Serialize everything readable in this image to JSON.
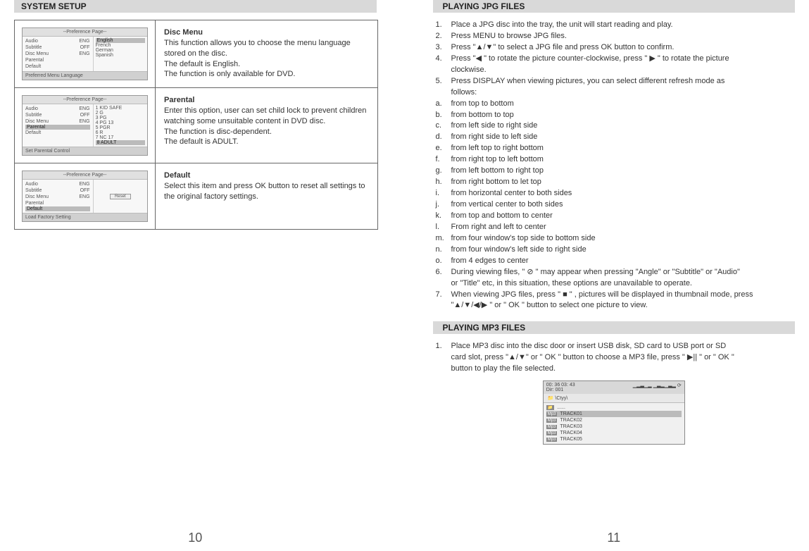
{
  "left": {
    "header": "SYSTEM SETUP",
    "rows": [
      {
        "title": "Disc Menu",
        "body1": "This function allows you to choose the menu language stored on the disc.",
        "body2": "The default is English.",
        "body3": "The function is only available for DVD.",
        "mock": {
          "title": "--Preference Page--",
          "left": [
            [
              "Audio",
              "ENG"
            ],
            [
              "Subtitle",
              "OFF"
            ],
            [
              "Disc Menu",
              "ENG"
            ],
            [
              "Parental",
              ""
            ],
            [
              "Default",
              ""
            ]
          ],
          "right": [
            "English",
            "French",
            "German",
            "Spanish"
          ],
          "highlightRight": 0,
          "footer": "Preferred Menu Language"
        }
      },
      {
        "title": "Parental",
        "body1": "Enter this option, user can set child lock to prevent children watching some unsuitable content in DVD disc.",
        "body2": "The function is disc-dependent.",
        "body3": "The default is ADULT.",
        "mock": {
          "title": "--Preference Page--",
          "left": [
            [
              "Audio",
              "ENG"
            ],
            [
              "Subtitle",
              "OFF"
            ],
            [
              "Disc Menu",
              "ENG"
            ],
            [
              "Parental",
              ""
            ],
            [
              "Default",
              ""
            ]
          ],
          "right": [
            "1  KID SAFE",
            "2  G",
            "3  PG",
            "4  PG 13",
            "5  PGR",
            "6  R",
            "7  NC 17",
            "8  ADULT"
          ],
          "highlightLeft": 3,
          "highlightRight": 7,
          "footer": "Set Parental Control"
        }
      },
      {
        "title": "Default",
        "body1": "Select this item and press OK button to reset all settings to the original factory settings.",
        "body2": "",
        "body3": "",
        "mock": {
          "title": "--Preference Page--",
          "left": [
            [
              "Audio",
              "ENG"
            ],
            [
              "Subtitle",
              "OFF"
            ],
            [
              "Disc Menu",
              "ENG"
            ],
            [
              "Parental",
              ""
            ],
            [
              "Default",
              ""
            ]
          ],
          "right": [],
          "highlightLeft": 4,
          "reset": "Reset",
          "footer": "Load Factory Setting"
        }
      }
    ],
    "pagenum": "10"
  },
  "right": {
    "header1": "PLAYING JPG FILES",
    "jpg": [
      [
        "1.",
        "Place a JPG disc into the tray, the unit will start reading and play."
      ],
      [
        "2.",
        "Press MENU to browse JPG files."
      ],
      [
        "3.",
        "Press \"▲/▼\" to select a JPG file and press OK button to confirm."
      ],
      [
        "4.",
        "Press \"◀  \" to rotate the picture counter-clockwise, press \" ▶ \" to rotate the picture"
      ],
      [
        "",
        "clockwise."
      ],
      [
        "5.",
        "Press DISPLAY when viewing pictures, you can select different refresh mode as"
      ],
      [
        "",
        "follows:"
      ],
      [
        "a.",
        "from top to bottom"
      ],
      [
        "b.",
        "from bottom to top"
      ],
      [
        "c.",
        "from left side to right side"
      ],
      [
        "d.",
        "from right side to left side"
      ],
      [
        "e.",
        "from left top to right bottom"
      ],
      [
        "f.",
        "from right top to left bottom"
      ],
      [
        "g.",
        "from left bottom to right top"
      ],
      [
        "h.",
        "from right bottom to let top"
      ],
      [
        "i.",
        "from horizontal center to both sides"
      ],
      [
        "j.",
        "from vertical center to both sides"
      ],
      [
        "k.",
        "from top and bottom to center"
      ],
      [
        "l.",
        "From right and left to center"
      ],
      [
        "m.",
        "from four window's top side to bottom side"
      ],
      [
        "n.",
        "from four window's left side to right side"
      ],
      [
        "o.",
        "from 4 edges to center"
      ],
      [
        "6.",
        "During viewing files, \" ⊘ \" may appear when pressing \"Angle\" or \"Subtitle\" or \"Audio\""
      ],
      [
        "",
        "or \"Title\" etc, in this situation, these options are unavailable to operate."
      ],
      [
        "7.",
        "When viewing JPG files, press \" ■ \" , pictures will be displayed in thumbnail mode, press"
      ],
      [
        "",
        "\"▲/▼/◀/▶ \" or \" OK \" button to select one picture to view."
      ]
    ],
    "header2": "PLAYING MP3 FILES",
    "mp3text": [
      [
        "1.",
        "Place MP3 disc into the disc door or insert USB disk, SD card to USB port or SD"
      ],
      [
        "",
        "card slot, press \"▲/▼\" or \" OK \" button to choose a MP3 file, press \"  ▶||  \" or \" OK \""
      ],
      [
        "",
        "button to play the file selected."
      ]
    ],
    "mp3box": {
      "time": "00: 36 03: 43",
      "dir": "Dir: 001",
      "path": "\\Ctyy\\",
      "dots": "......",
      "tracks": [
        "TRACK01",
        "TRACK02",
        "TRACK03",
        "TRACK04",
        "TRACK05"
      ],
      "selected": 0
    },
    "pagenum": "11"
  }
}
